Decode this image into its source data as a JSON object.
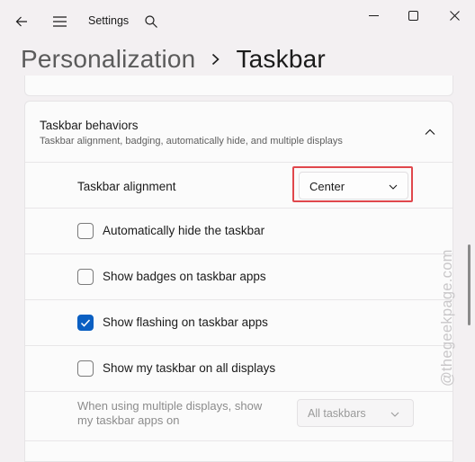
{
  "window": {
    "title": "Settings"
  },
  "header": {
    "parent": "Personalization",
    "current": "Taskbar"
  },
  "section": {
    "title": "Taskbar behaviors",
    "subtitle": "Taskbar alignment, badging, automatically hide, and multiple displays"
  },
  "alignment": {
    "label": "Taskbar alignment",
    "value": "Center"
  },
  "options": [
    {
      "label": "Automatically hide the taskbar",
      "checked": false
    },
    {
      "label": "Show badges on taskbar apps",
      "checked": false
    },
    {
      "label": "Show flashing on taskbar apps",
      "checked": true
    },
    {
      "label": "Show my taskbar on all displays",
      "checked": false
    }
  ],
  "multi_display": {
    "label_line1": "When using multiple displays, show",
    "label_line2": "my taskbar apps on",
    "value": "All taskbars"
  },
  "watermark": "@thegeekpage.com",
  "colors": {
    "accent": "#0a5fc2",
    "highlight": "#e0474c"
  },
  "icons": [
    "back-arrow-icon",
    "hamburger-menu-icon",
    "search-icon",
    "minimize-icon",
    "maximize-icon",
    "close-icon",
    "chevron-right-icon",
    "chevron-up-icon",
    "chevron-down-icon",
    "checkmark-icon"
  ]
}
